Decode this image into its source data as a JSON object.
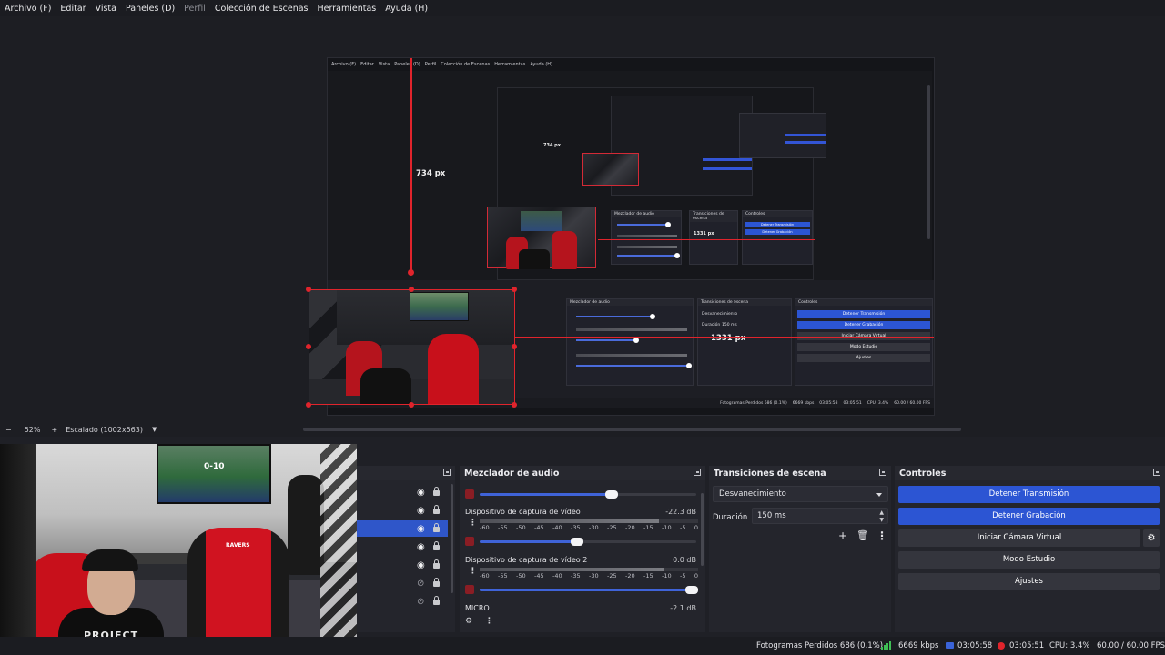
{
  "menu": {
    "items": [
      "Archivo (F)",
      "Editar",
      "Vista",
      "Paneles (D)",
      "Perfil",
      "Colección de Escenas",
      "Herramientas",
      "Ayuda (H)"
    ]
  },
  "preview": {
    "measure_vertical": "734 px",
    "measure_horizontal": "1331 px",
    "nested_vertical": "734 px",
    "nested_horizontal": "1331 px"
  },
  "scale": {
    "minus": "−",
    "zoom": "52%",
    "plus": "+",
    "mode": "Escalado (1002x563)"
  },
  "sources": {
    "rows": [
      {
        "visible": true,
        "selected": false
      },
      {
        "visible": true,
        "selected": false
      },
      {
        "visible": true,
        "selected": true
      },
      {
        "visible": true,
        "selected": false
      },
      {
        "visible": true,
        "selected": false
      },
      {
        "visible": false,
        "selected": false
      },
      {
        "visible": false,
        "selected": false
      }
    ]
  },
  "mixer": {
    "title": "Mezclador de audio",
    "ticks": [
      "-60",
      "-55",
      "-50",
      "-45",
      "-40",
      "-35",
      "-30",
      "-25",
      "-20",
      "-15",
      "-10",
      "-5",
      "0"
    ],
    "channels": [
      {
        "name": "Dispositivo de captura de vídeo",
        "db": "-22.3 dB",
        "slider": 0.61,
        "meter": 0.82
      },
      {
        "name": "Dispositivo de captura de vídeo 2",
        "db": "0.0 dB",
        "slider": 0.45,
        "meter": 0.84
      },
      {
        "name": "MICRO",
        "db": "-2.1 dB",
        "slider": 0.98,
        "meter": 0.0
      }
    ]
  },
  "transitions": {
    "title": "Transiciones de escena",
    "selected": "Desvanecimiento",
    "duration_label": "Duración",
    "duration_value": "150 ms"
  },
  "controls": {
    "title": "Controles",
    "stop_stream": "Detener Transmisión",
    "stop_recording": "Detener Grabación",
    "virtual_cam": "Iniciar Cámara Virtual",
    "studio_mode": "Modo Estudio",
    "settings": "Ajustes"
  },
  "status": {
    "dropped_frames": "Fotogramas Perdidos 686 (0.1%)",
    "bitrate": "6669 kbps",
    "stream_time": "03:05:58",
    "rec_time": "03:05:51",
    "cpu": "CPU: 3.4%",
    "fps": "60.00 / 60.00 FPS"
  },
  "nested": {
    "mixer_title": "Mezclador de audio",
    "transitions_title": "Transiciones de escena",
    "controls_title": "Controles",
    "stop_stream": "Detener Transmisión",
    "stop_recording": "Detener Grabación",
    "virtual_cam": "Iniciar Cámara Virtual",
    "studio_mode": "Modo Estudio",
    "settings": "Ajustes",
    "fade": "Desvanecimiento",
    "duration": "Duración",
    "duration_value": "150 ms",
    "status": [
      "Fotogramas Perdidos 686 (0.1%)",
      "6669 kbps",
      "03:05:58",
      "03:05:51",
      "CPU: 3.4%",
      "60.00 / 60.00 FPS"
    ]
  },
  "webcam": {
    "tv_score": "0-10",
    "shirt_text": "PROJECT",
    "chair_tag": "RAVERS"
  },
  "colors": {
    "accent": "#2c55d3",
    "selection_red": "#e0242c"
  }
}
